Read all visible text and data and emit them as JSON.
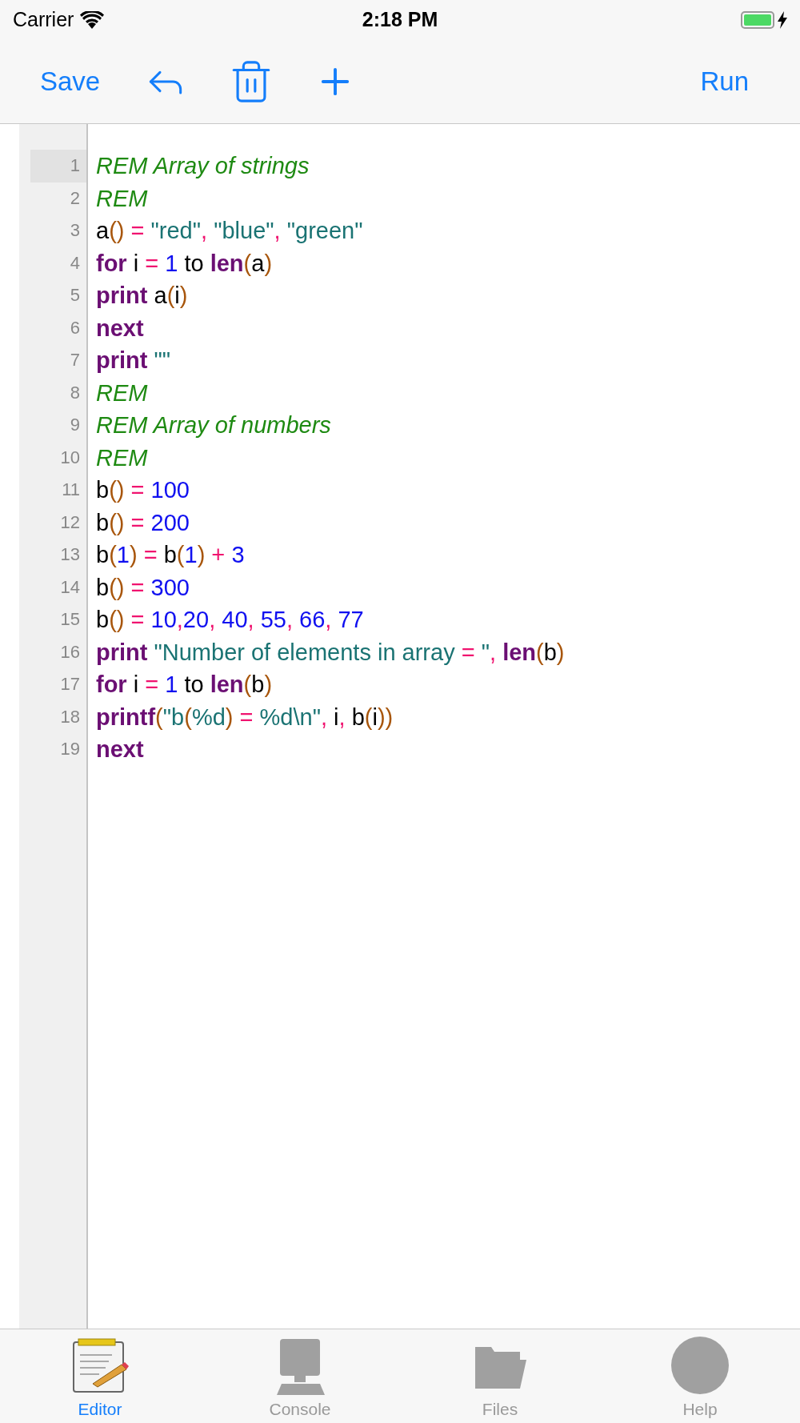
{
  "status_bar": {
    "carrier": "Carrier",
    "time": "2:18 PM",
    "battery": {
      "level": 1,
      "charging": true
    }
  },
  "toolbar": {
    "left": [
      {
        "kind": "text",
        "label": "Save"
      },
      {
        "kind": "undo"
      },
      {
        "kind": "trash"
      },
      {
        "kind": "add"
      }
    ],
    "right": {
      "kind": "text",
      "label": "Run"
    }
  },
  "editor": {
    "lines": [
      {
        "number": "1",
        "selected": true,
        "tokens": [
          {
            "kind": "comment",
            "text": "REM Array of strings"
          }
        ]
      },
      {
        "number": "2",
        "selected": false,
        "tokens": [
          {
            "kind": "comment",
            "text": "REM"
          }
        ]
      },
      {
        "number": "3",
        "selected": false,
        "tokens": [
          {
            "kind": "plain",
            "text": "a"
          },
          {
            "kind": "paren",
            "text": "()"
          },
          {
            "kind": "op",
            "text": " = "
          },
          {
            "kind": "string",
            "text": "\"red\""
          },
          {
            "kind": "op",
            "text": ", "
          },
          {
            "kind": "string",
            "text": "\"blue\""
          },
          {
            "kind": "op",
            "text": ", "
          },
          {
            "kind": "string",
            "text": "\"green\""
          }
        ]
      },
      {
        "number": "4",
        "selected": false,
        "tokens": [
          {
            "kind": "keyword",
            "text": "for"
          },
          {
            "kind": "plain",
            "text": " i "
          },
          {
            "kind": "op",
            "text": "="
          },
          {
            "kind": "number",
            "text": " 1"
          },
          {
            "kind": "plain",
            "text": " to "
          },
          {
            "kind": "keyword",
            "text": "len"
          },
          {
            "kind": "paren",
            "text": "("
          },
          {
            "kind": "plain",
            "text": "a"
          },
          {
            "kind": "paren",
            "text": ")"
          }
        ]
      },
      {
        "number": "5",
        "selected": false,
        "tokens": [
          {
            "kind": "keyword",
            "text": "print"
          },
          {
            "kind": "plain",
            "text": " a"
          },
          {
            "kind": "paren",
            "text": "("
          },
          {
            "kind": "plain",
            "text": "i"
          },
          {
            "kind": "paren",
            "text": ")"
          }
        ]
      },
      {
        "number": "6",
        "selected": false,
        "tokens": [
          {
            "kind": "keyword",
            "text": "next"
          }
        ]
      },
      {
        "number": "7",
        "selected": false,
        "tokens": [
          {
            "kind": "keyword",
            "text": "print"
          },
          {
            "kind": "string",
            "text": " \"\""
          }
        ]
      },
      {
        "number": "8",
        "selected": false,
        "tokens": [
          {
            "kind": "comment",
            "text": "REM"
          }
        ]
      },
      {
        "number": "9",
        "selected": false,
        "tokens": [
          {
            "kind": "comment",
            "text": "REM Array of numbers"
          }
        ]
      },
      {
        "number": "10",
        "selected": false,
        "tokens": [
          {
            "kind": "comment",
            "text": "REM"
          }
        ]
      },
      {
        "number": "11",
        "selected": false,
        "tokens": [
          {
            "kind": "plain",
            "text": "b"
          },
          {
            "kind": "paren",
            "text": "()"
          },
          {
            "kind": "op",
            "text": " = "
          },
          {
            "kind": "number",
            "text": "100"
          }
        ]
      },
      {
        "number": "12",
        "selected": false,
        "tokens": [
          {
            "kind": "plain",
            "text": "b"
          },
          {
            "kind": "paren",
            "text": "()"
          },
          {
            "kind": "op",
            "text": " = "
          },
          {
            "kind": "number",
            "text": "200"
          }
        ]
      },
      {
        "number": "13",
        "selected": false,
        "tokens": [
          {
            "kind": "plain",
            "text": "b"
          },
          {
            "kind": "paren",
            "text": "("
          },
          {
            "kind": "number",
            "text": "1"
          },
          {
            "kind": "paren",
            "text": ")"
          },
          {
            "kind": "op",
            "text": " = "
          },
          {
            "kind": "plain",
            "text": "b"
          },
          {
            "kind": "paren",
            "text": "("
          },
          {
            "kind": "number",
            "text": "1"
          },
          {
            "kind": "paren",
            "text": ")"
          },
          {
            "kind": "op",
            "text": " + "
          },
          {
            "kind": "number",
            "text": "3"
          }
        ]
      },
      {
        "number": "14",
        "selected": false,
        "tokens": [
          {
            "kind": "plain",
            "text": "b"
          },
          {
            "kind": "paren",
            "text": "()"
          },
          {
            "kind": "op",
            "text": " = "
          },
          {
            "kind": "number",
            "text": "300"
          }
        ]
      },
      {
        "number": "15",
        "selected": false,
        "tokens": [
          {
            "kind": "plain",
            "text": "b"
          },
          {
            "kind": "paren",
            "text": "()"
          },
          {
            "kind": "op",
            "text": " = "
          },
          {
            "kind": "number",
            "text": "10"
          },
          {
            "kind": "op",
            "text": ","
          },
          {
            "kind": "number",
            "text": "20"
          },
          {
            "kind": "op",
            "text": ", "
          },
          {
            "kind": "number",
            "text": "40"
          },
          {
            "kind": "op",
            "text": ", "
          },
          {
            "kind": "number",
            "text": "55"
          },
          {
            "kind": "op",
            "text": ", "
          },
          {
            "kind": "number",
            "text": "66"
          },
          {
            "kind": "op",
            "text": ", "
          },
          {
            "kind": "number",
            "text": "77"
          }
        ]
      },
      {
        "number": "16",
        "selected": false,
        "tokens": [
          {
            "kind": "keyword",
            "text": "print"
          },
          {
            "kind": "string",
            "text": " \"Number of elements in array "
          },
          {
            "kind": "op",
            "text": "="
          },
          {
            "kind": "string",
            "text": " \""
          },
          {
            "kind": "op",
            "text": ", "
          },
          {
            "kind": "keyword",
            "text": "len"
          },
          {
            "kind": "paren",
            "text": "("
          },
          {
            "kind": "plain",
            "text": "b"
          },
          {
            "kind": "paren",
            "text": ")"
          }
        ]
      },
      {
        "number": "17",
        "selected": false,
        "tokens": [
          {
            "kind": "keyword",
            "text": "for"
          },
          {
            "kind": "plain",
            "text": " i "
          },
          {
            "kind": "op",
            "text": "="
          },
          {
            "kind": "number",
            "text": " 1"
          },
          {
            "kind": "plain",
            "text": " to "
          },
          {
            "kind": "keyword",
            "text": "len"
          },
          {
            "kind": "paren",
            "text": "("
          },
          {
            "kind": "plain",
            "text": "b"
          },
          {
            "kind": "paren",
            "text": ")"
          }
        ]
      },
      {
        "number": "18",
        "selected": false,
        "tokens": [
          {
            "kind": "keyword",
            "text": "printf"
          },
          {
            "kind": "paren",
            "text": "("
          },
          {
            "kind": "string",
            "text": "\"b"
          },
          {
            "kind": "paren",
            "text": "("
          },
          {
            "kind": "string",
            "text": "%d"
          },
          {
            "kind": "paren",
            "text": ")"
          },
          {
            "kind": "op",
            "text": " = "
          },
          {
            "kind": "string",
            "text": "%d\\n\""
          },
          {
            "kind": "op",
            "text": ", "
          },
          {
            "kind": "plain",
            "text": "i"
          },
          {
            "kind": "op",
            "text": ", "
          },
          {
            "kind": "plain",
            "text": "b"
          },
          {
            "kind": "paren",
            "text": "("
          },
          {
            "kind": "plain",
            "text": "i"
          },
          {
            "kind": "paren",
            "text": "))"
          }
        ]
      },
      {
        "number": "19",
        "selected": false,
        "tokens": [
          {
            "kind": "keyword",
            "text": "next"
          }
        ]
      }
    ]
  },
  "tab_bar": [
    {
      "kind": "editor",
      "label": "Editor",
      "selected": true
    },
    {
      "kind": "console",
      "label": "Console",
      "selected": false
    },
    {
      "kind": "files",
      "label": "Files",
      "selected": false
    },
    {
      "kind": "help",
      "label": "Help",
      "selected": false
    }
  ]
}
